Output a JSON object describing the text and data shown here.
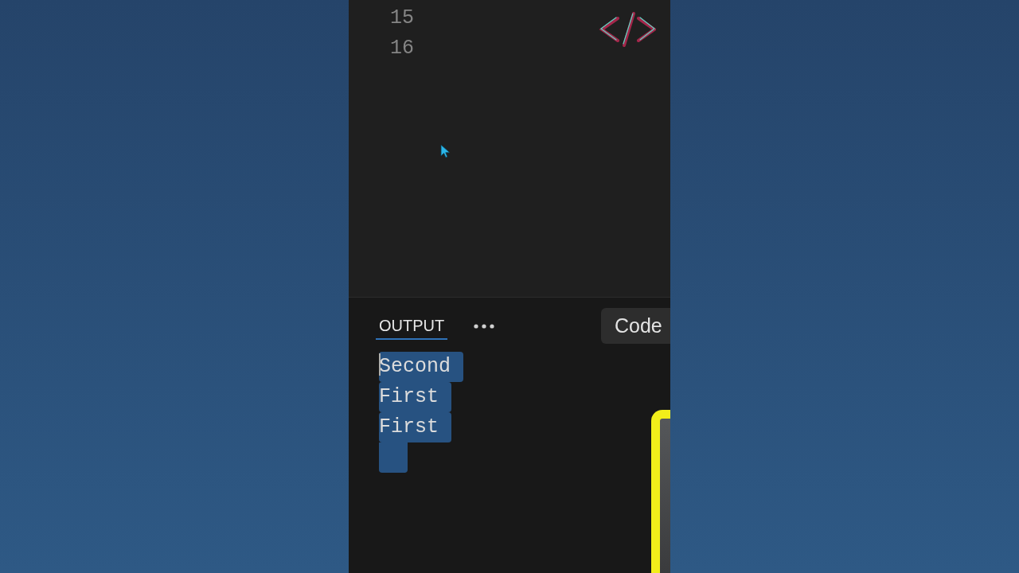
{
  "editor": {
    "line_numbers": [
      "15",
      "16"
    ]
  },
  "panel": {
    "tabs": [
      {
        "label": "OUTPUT",
        "selected": true
      }
    ],
    "code_button": {
      "label": "Code"
    },
    "output": {
      "lines": [
        {
          "text": "Second",
          "selected": true,
          "caret": true
        },
        {
          "text": "First",
          "selected": true,
          "caret": false
        },
        {
          "text": "First",
          "selected": true,
          "caret": false
        }
      ],
      "trailing_selection": true
    }
  }
}
